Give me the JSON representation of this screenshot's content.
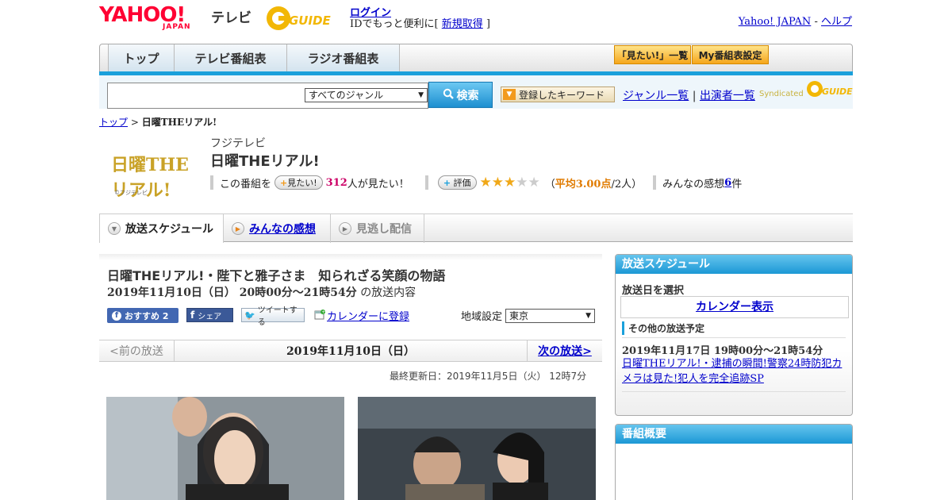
{
  "header": {
    "brand": "YAHOO!",
    "brand_sub": "JAPAN",
    "tv_label": "テレビ",
    "gguide_label": "GUIDE",
    "login": "ログイン",
    "login_prefix": "IDでもっと便利に[ ",
    "signup": "新規取得",
    "login_suffix": " ]",
    "yahoo_japan": "Yahoo! JAPAN",
    "dash": " - ",
    "help": "ヘルプ"
  },
  "main_tabs": [
    {
      "label": "トップ"
    },
    {
      "label": "テレビ番組表"
    },
    {
      "label": "ラジオ番組表"
    }
  ],
  "top_buttons": {
    "watchlist": "「見たい!」一覧",
    "my_settings": "My番組表設定"
  },
  "search": {
    "placeholder": "",
    "genre_selected": "すべてのジャンル",
    "button": "検索",
    "keyword_button": "登録したキーワード",
    "genre_list": "ジャンル一覧",
    "divider": " | ",
    "performer_list": "出演者一覧",
    "syndicated": "Syndicated"
  },
  "breadcrumb": {
    "top": "トップ",
    "sep": " > ",
    "current": "日曜THEリアル!"
  },
  "program": {
    "logo_text": "日曜THEリアル!",
    "logo_copy": "©フジテレビ",
    "channel": "フジテレビ",
    "title": "日曜THEリアル!",
    "want_prefix": "この番組を",
    "want_button": "見たい!",
    "want_count": "312",
    "want_suffix": "人が見たい！",
    "rate_button": "評価",
    "rating_stars": 3,
    "rating_max": 5,
    "rating_text_prefix": "（",
    "rating_avg": "平均3.00点",
    "rating_people": "/2人）",
    "reviews_prefix": "みんなの感想 ",
    "reviews_count": "6",
    "reviews_suffix": "件"
  },
  "sub_tabs": [
    {
      "label": "放送スケジュール"
    },
    {
      "label": "みんなの感想"
    },
    {
      "label": "見逃し配信"
    }
  ],
  "episode": {
    "title": "日曜THEリアル!・陛下と雅子さま　知られざる笑顔の物語",
    "date_bold": "2019年11月10日（日） 20時00分～21時54分",
    "date_suffix": "の放送内容",
    "fb_recommend": "おすすめ 2",
    "fb_share": "シェア",
    "tweet": "ツイートする",
    "calendar_register": "カレンダーに登録",
    "region_label": "地域設定",
    "region_value": "東京",
    "prev": "<前の放送",
    "current_date": "2019年11月10日（日）",
    "next": "次の放送>",
    "updated": "最終更新日：2019年11月5日（火） 12時7分"
  },
  "sidebar": {
    "schedule_title": "放送スケジュール",
    "pick_date": "放送日を選択",
    "calendar_show": "カレンダー表示",
    "other_heading": "その他の放送予定",
    "other_date": "2019年11月17日 19時00分～21時54分",
    "other_title": "日曜THEリアル!・逮捕の瞬間!警察24時防犯カメラは見た!犯人を完全追跡SP",
    "overview_title": "番組概要"
  },
  "colors": {
    "accent_blue": "#1aa0db",
    "yahoo_red": "#ff0033",
    "star": "#f0a818",
    "want_count": "#cc0066",
    "rating_avg": "#e07b00"
  }
}
